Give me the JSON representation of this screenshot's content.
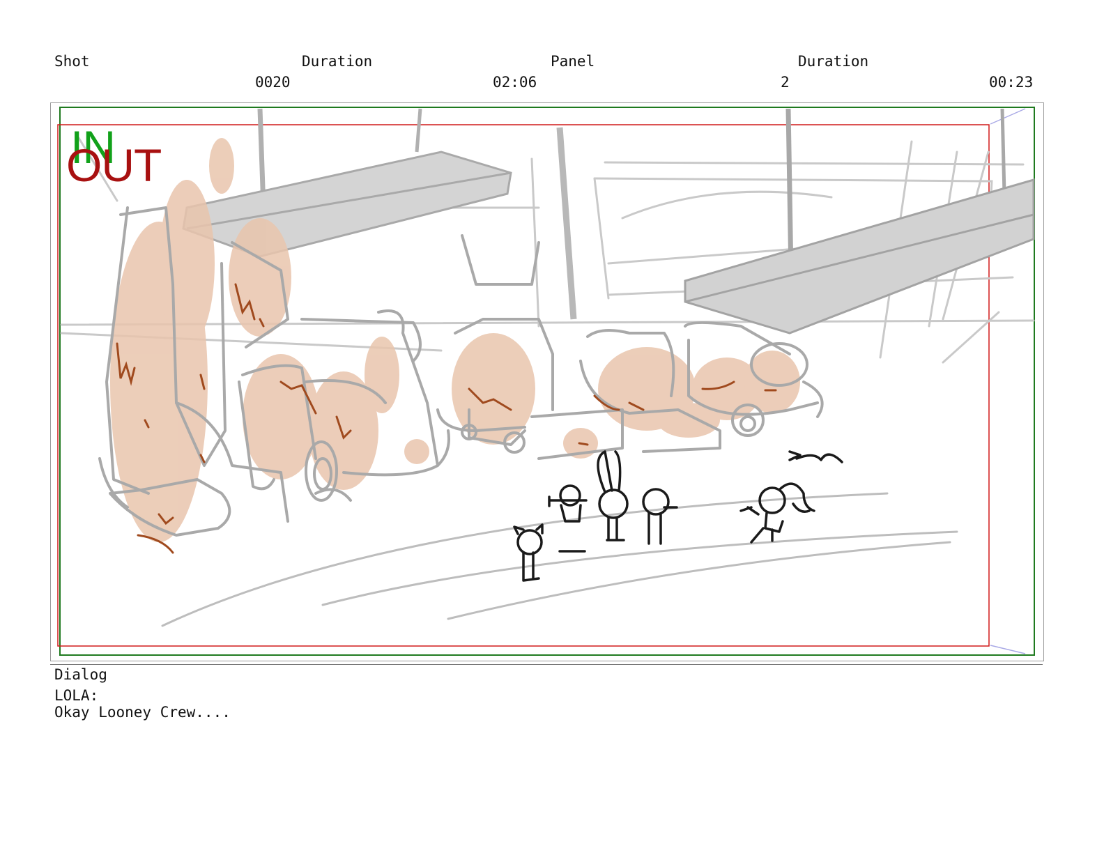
{
  "header": {
    "shot_label": "Shot",
    "shot_duration_label": "Duration",
    "panel_label": "Panel",
    "panel_duration_label": "Duration",
    "shot_value": "0020",
    "shot_duration_value": "02:06",
    "panel_value": "2",
    "panel_duration_value": "00:23"
  },
  "panel": {
    "in_marker": "IN",
    "out_marker": "OUT",
    "colors": {
      "in": "#11a11a",
      "out": "#a81010",
      "safe_inner": "#d11a1a",
      "safe_outer": "#1f7a1f",
      "flesh": "#e8c3ab",
      "roof": "#cfcfcf"
    }
  },
  "dialog": {
    "label": "Dialog",
    "speaker": "LOLA:",
    "line": "Okay Looney Crew...."
  }
}
